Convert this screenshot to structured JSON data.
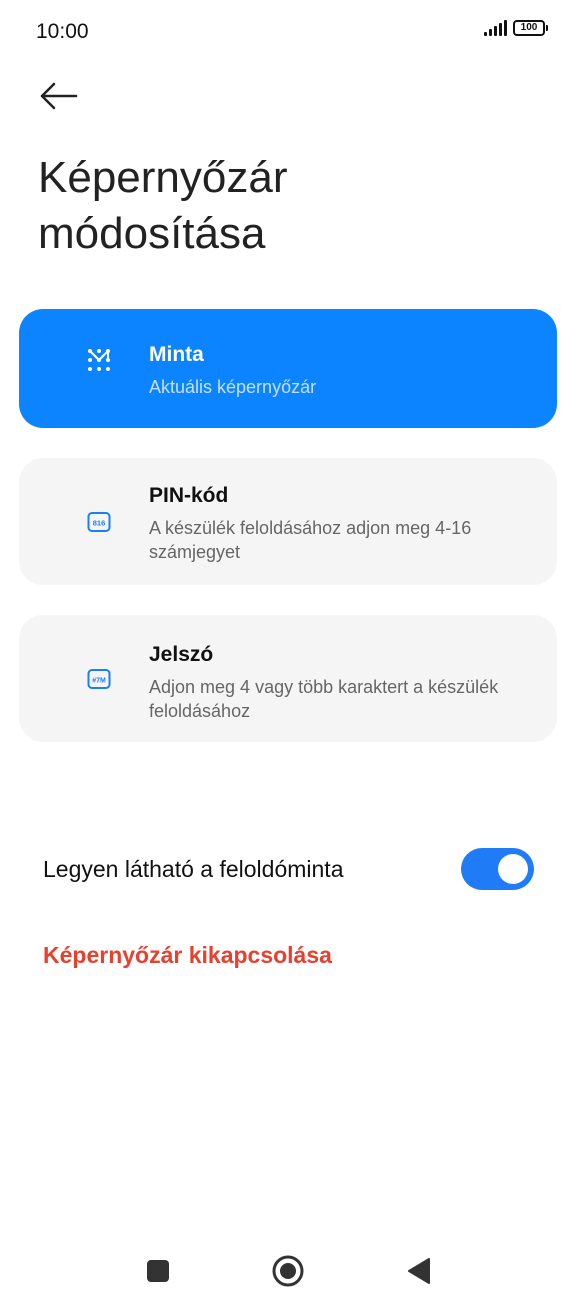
{
  "status_bar": {
    "time": "10:00",
    "battery": "100"
  },
  "header": {
    "title": "Képernyőzár módosítása"
  },
  "options": [
    {
      "title": "Minta",
      "description": "Aktuális képernyőzár",
      "icon": "pattern-icon",
      "selected": true
    },
    {
      "title": "PIN-kód",
      "description": "A készülék feloldásához adjon meg 4-16 számjegyet",
      "icon": "pin-icon",
      "icon_text": "816",
      "selected": false
    },
    {
      "title": "Jelszó",
      "description": "Adjon meg 4 vagy több karaktert a készülék feloldásához",
      "icon": "password-icon",
      "icon_text": "#7M",
      "selected": false
    }
  ],
  "settings": {
    "visible_pattern_label": "Legyen látható a feloldóminta",
    "visible_pattern_enabled": true,
    "disable_lock_label": "Képernyőzár kikapcsolása"
  },
  "colors": {
    "accent": "#0d84ff",
    "toggle": "#1f7bf6",
    "danger": "#e8402f",
    "card_bg": "#f5f5f5"
  }
}
